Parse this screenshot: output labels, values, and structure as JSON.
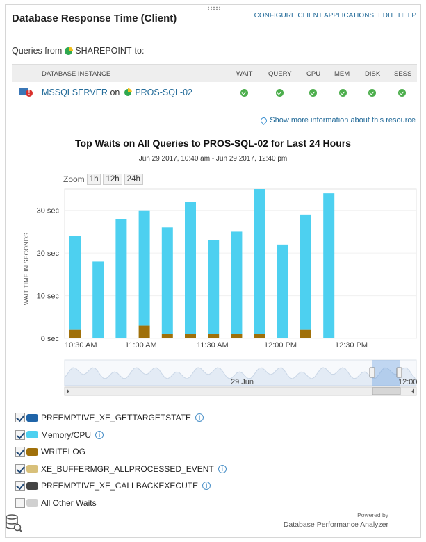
{
  "panel": {
    "title": "Database Response Time (Client)",
    "links": [
      "CONFIGURE CLIENT APPLICATIONS",
      "EDIT",
      "HELP"
    ]
  },
  "queries": {
    "prefix": "Queries from",
    "source": "SHAREPOINT",
    "suffix": "to:"
  },
  "table": {
    "headers": [
      "DATABASE INSTANCE",
      "WAIT",
      "QUERY",
      "CPU",
      "MEM",
      "DISK",
      "SESS"
    ],
    "row": {
      "instance": "MSSQLSERVER",
      "on": "on",
      "host": "PROS-SQL-02",
      "statuses": [
        "ok",
        "ok",
        "ok",
        "ok",
        "ok",
        "ok"
      ]
    }
  },
  "more_info": "Show more information about this resource",
  "zoom": {
    "label": "Zoom",
    "options": [
      "1h",
      "12h",
      "24h"
    ]
  },
  "navigator": {
    "date_label": "29 Jun",
    "right_label": "12:00"
  },
  "chart_data": {
    "type": "bar",
    "title": "Top Waits on All Queries to PROS-SQL-02 for Last 24 Hours",
    "subtitle": "Jun 29 2017, 10:40 am - Jun 29 2017, 12:40 pm",
    "ylabel": "WAIT TIME IN SECONDS",
    "ylim": [
      0,
      35
    ],
    "yticks": [
      0,
      10,
      20,
      30
    ],
    "ytick_labels": [
      "0 sec",
      "10 sec",
      "20 sec",
      "30 sec"
    ],
    "xtick_labels": [
      "10:30 AM",
      "11:00 AM",
      "11:30 AM",
      "12:00 PM",
      "12:30 PM"
    ],
    "categories": [
      "10:30",
      "10:40",
      "10:50",
      "11:00",
      "11:10",
      "11:20",
      "11:30",
      "11:40",
      "11:50",
      "12:00",
      "12:10",
      "12:20"
    ],
    "series": [
      {
        "name": "Memory/CPU",
        "color": "#4dd0f0",
        "values": [
          22,
          18,
          28,
          27,
          25,
          31,
          22,
          24,
          34,
          22,
          27,
          34
        ]
      },
      {
        "name": "WRITELOG",
        "color": "#a0700a",
        "values": [
          2,
          0,
          0,
          3,
          1,
          1,
          1,
          1,
          1,
          0,
          2,
          0
        ]
      }
    ]
  },
  "legend": [
    {
      "label": "PREEMPTIVE_XE_GETTARGETSTATE",
      "color": "#1f64a8",
      "checked": true,
      "info": true
    },
    {
      "label": "Memory/CPU",
      "color": "#4dd0f0",
      "checked": true,
      "info": true
    },
    {
      "label": "WRITELOG",
      "color": "#a0700a",
      "checked": true,
      "info": false
    },
    {
      "label": "XE_BUFFERMGR_ALLPROCESSED_EVENT",
      "color": "#d8c07a",
      "checked": true,
      "info": true
    },
    {
      "label": "PREEMPTIVE_XE_CALLBACKEXECUTE",
      "color": "#444444",
      "checked": true,
      "info": true
    },
    {
      "label": "All Other Waits",
      "color": "#d0d0d0",
      "checked": false,
      "info": false
    }
  ],
  "powered": {
    "by": "Powered by",
    "name": "Database Performance Analyzer"
  }
}
